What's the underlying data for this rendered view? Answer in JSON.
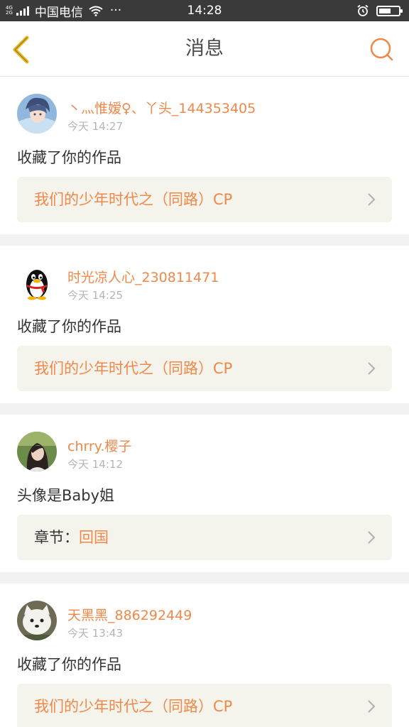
{
  "status_bar": {
    "network_top": "4G",
    "network_bottom": "2G",
    "carrier": "中国电信",
    "more": "···",
    "time": "14:28",
    "battery_level": 0.6
  },
  "nav": {
    "title": "消息",
    "back_icon": "chevron-left-icon",
    "search_icon": "search-icon"
  },
  "messages": [
    {
      "username": "丶灬惟嫒♀、丫头_144353405",
      "time": "今天 14:27",
      "content": "收藏了你的作品",
      "ref_prefix": "",
      "ref_text": "我们的少年时代之（同路）CP"
    },
    {
      "username": "时光凉人心_230811471",
      "time": "今天 14:25",
      "content": "收藏了你的作品",
      "ref_prefix": "",
      "ref_text": "我们的少年时代之（同路）CP"
    },
    {
      "username": "chrry.樱子",
      "time": "今天 14:12",
      "content": "头像是Baby姐",
      "ref_prefix": "章节：",
      "ref_text": "回国"
    },
    {
      "username": "天黑黑_886292449",
      "time": "今天 13:43",
      "content": "收藏了你的作品",
      "ref_prefix": "",
      "ref_text": "我们的少年时代之（同路）CP"
    }
  ],
  "colors": {
    "accent": "#f0884a",
    "status_bar": "#3a3a3a",
    "ref_bg": "#f4f3ec",
    "divider": "#f2f2f2",
    "back_icon": "#e8b61a"
  }
}
